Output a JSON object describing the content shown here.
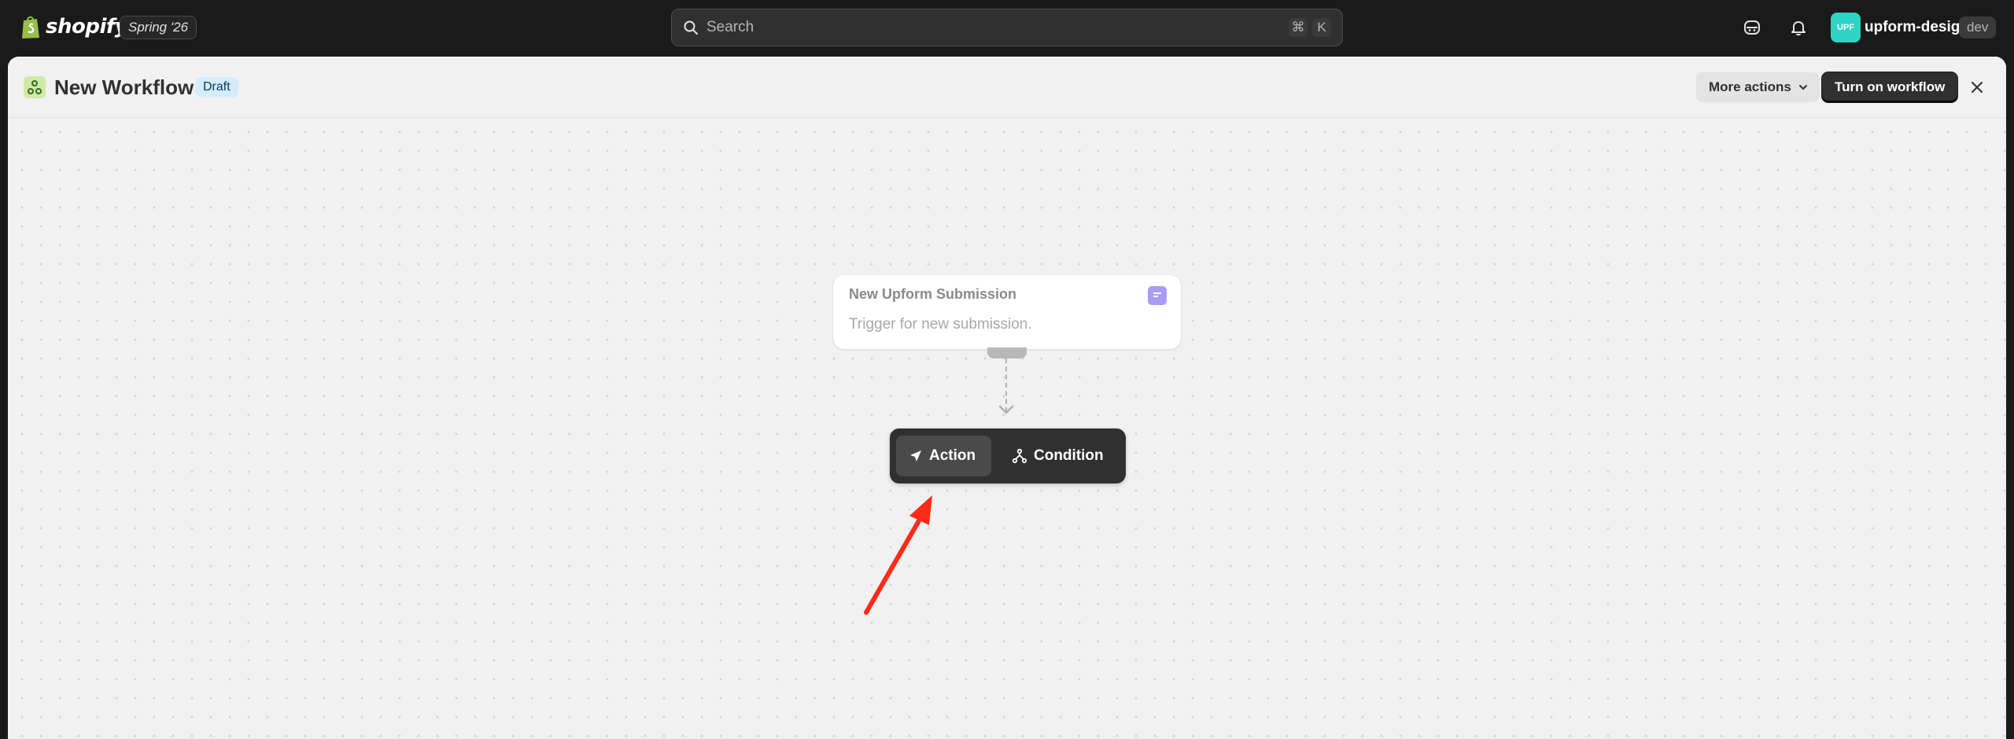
{
  "topbar": {
    "brand": "shopify",
    "season_badge": "Spring '26",
    "search": {
      "placeholder": "Search",
      "shortcut_cmd": "⌘",
      "shortcut_key": "K"
    },
    "store": {
      "avatar_initials": "UPF",
      "name": "upform-design",
      "badge": "dev"
    },
    "icons": [
      "shopify-bag-icon",
      "search-icon",
      "sidekick-icon",
      "bell-icon"
    ]
  },
  "header": {
    "title": "New Workflow",
    "status_badge": "Draft",
    "more_actions_label": "More actions",
    "turn_on_label": "Turn on workflow"
  },
  "canvas": {
    "trigger": {
      "title": "New Upform Submission",
      "description": "Trigger for new submission."
    },
    "step_menu": {
      "options": [
        {
          "label": "Action",
          "icon": "send-arrow-icon",
          "active": true
        },
        {
          "label": "Condition",
          "icon": "branch-icon",
          "active": false
        }
      ]
    }
  },
  "colors": {
    "topbar_bg": "#1a1a1a",
    "canvas_bg": "#f1f1f1",
    "draft_badge_bg": "#d5ebff",
    "primary_button": "#303030",
    "avatar": "#2ed3c3",
    "annotation_arrow": "#ff2a17"
  }
}
